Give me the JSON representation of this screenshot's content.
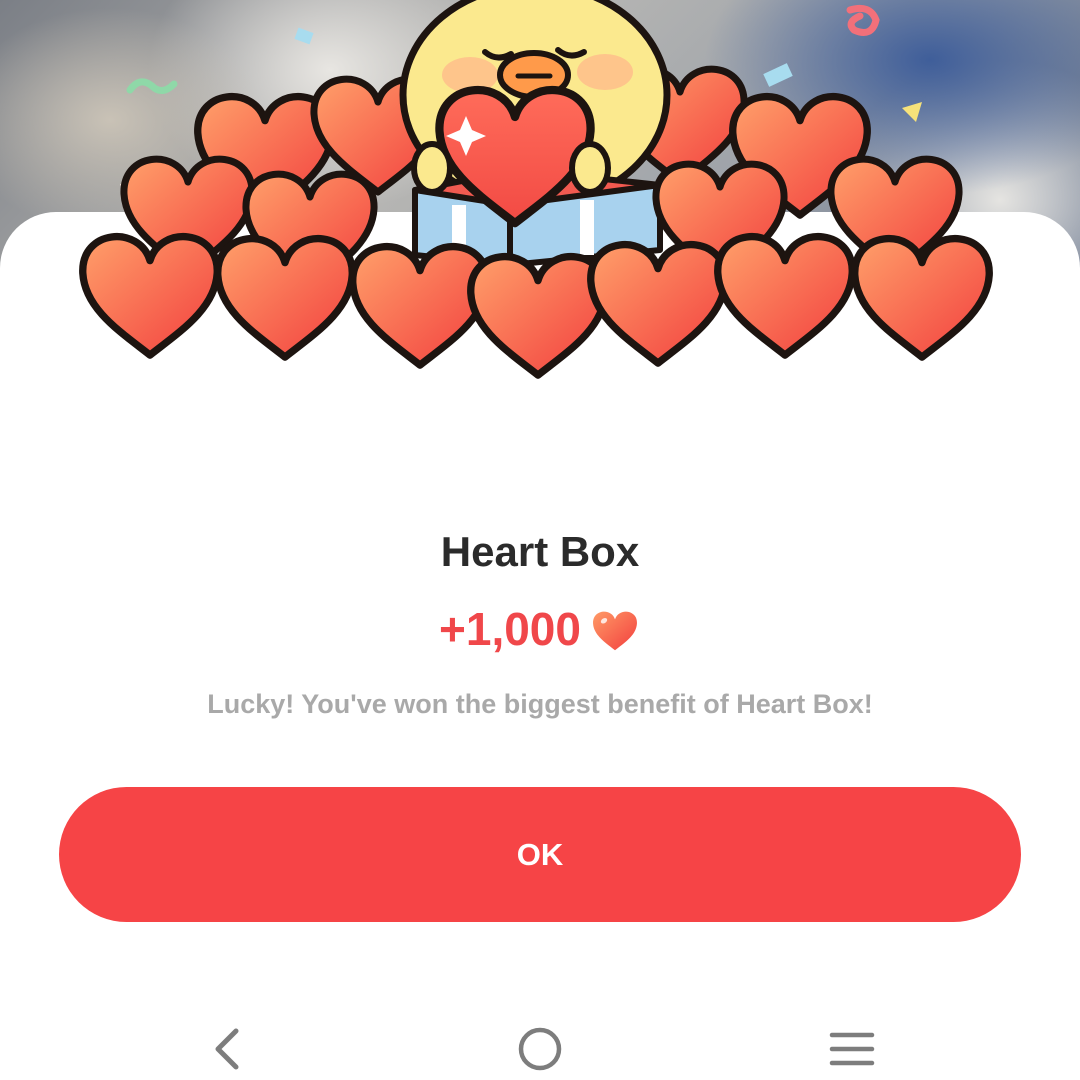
{
  "dialog": {
    "title": "Heart Box",
    "reward_amount": "+1,000",
    "message": "Lucky! You've won the biggest benefit of Heart Box!",
    "ok_label": "OK"
  },
  "icons": {
    "reward": "heart-icon",
    "nav_back": "back-chevron-icon",
    "nav_home": "home-circle-icon",
    "nav_recents": "menu-lines-icon"
  },
  "colors": {
    "accent": "#f64446",
    "reward_text": "#f0474a",
    "title_text": "#2b2b2b",
    "message_text": "#a9a9a9",
    "heart_light": "#ffa06a",
    "heart_dark": "#f23e3e",
    "character_yellow": "#fbe98e"
  }
}
